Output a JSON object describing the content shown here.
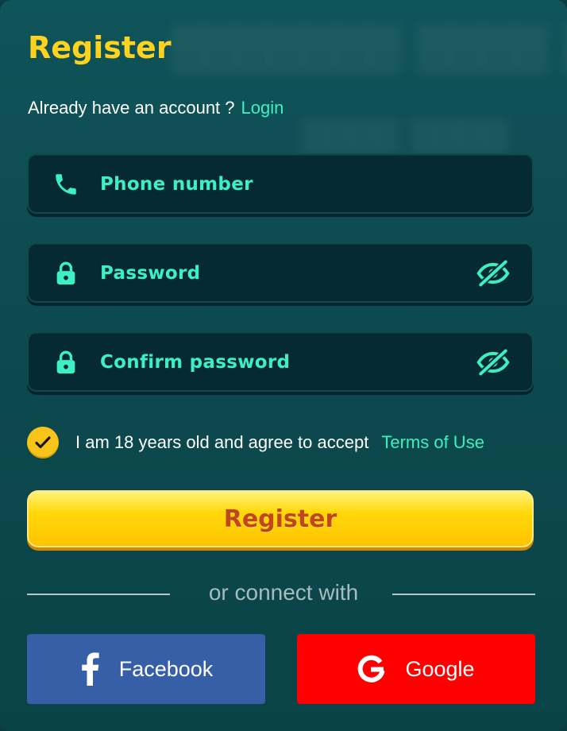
{
  "form": {
    "title": "Register",
    "login_prompt": "Already have an account ?",
    "login_link": "Login",
    "fields": [
      {
        "label": "Phone number",
        "icon": "phone-icon"
      },
      {
        "label": "Password",
        "icon": "lock-icon",
        "toggle_icon": "eye-hidden-icon"
      },
      {
        "label": "Confirm password",
        "icon": "lock-icon",
        "toggle_icon": "eye-hidden-icon"
      }
    ],
    "agree_text": "I am 18 years old and agree to accept",
    "terms_link": "Terms of Use",
    "agree_checked": true,
    "register_button": "Register",
    "connect_text": "or connect with",
    "facebook_label": "Facebook",
    "google_label": "Google"
  },
  "colors": {
    "accent_teal": "#3df0c3",
    "title_yellow": "#ffd21f",
    "facebook": "#365fa8",
    "google": "#ff0000",
    "register_text": "#c0471c"
  }
}
